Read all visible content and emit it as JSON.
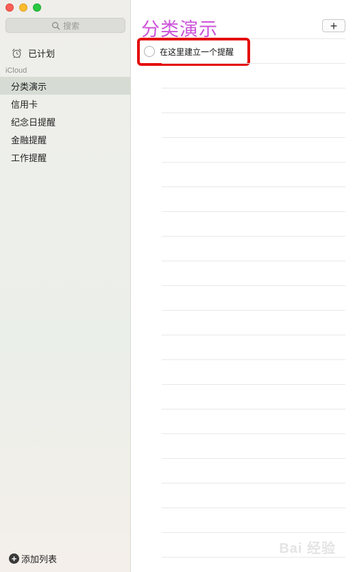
{
  "sidebar": {
    "search_placeholder": "搜索",
    "scheduled_label": "已计划",
    "section_label": "iCloud",
    "lists": [
      {
        "label": "分类演示",
        "selected": true
      },
      {
        "label": "信用卡",
        "selected": false
      },
      {
        "label": "纪念日提醒",
        "selected": false
      },
      {
        "label": "金融提醒",
        "selected": false
      },
      {
        "label": "工作提醒",
        "selected": false
      }
    ],
    "add_list_label": "添加列表"
  },
  "main": {
    "title": "分类演示",
    "add_button_label": "+",
    "new_reminder_placeholder": "在这里建立一个提醒",
    "title_color": "#cc53d9",
    "highlight_color": "#e30b0b"
  },
  "watermark": "Bai 经验"
}
